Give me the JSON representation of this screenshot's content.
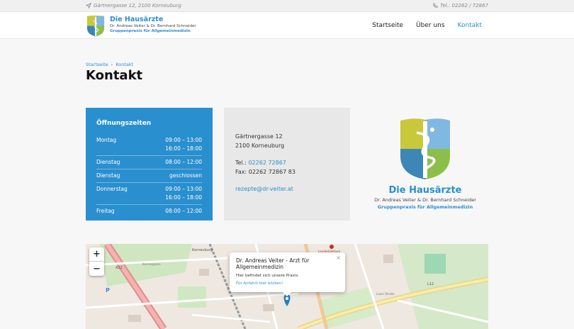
{
  "topbar": {
    "address": "Gärtnergasse 12, 2100 Korneuburg",
    "phone": "Tel.: 02262 / 72867"
  },
  "brand": {
    "name": "Die Hausärzte",
    "doctors": "Dr. Andreas Veiter & Dr. Bernhard Schneider",
    "tagline": "Gruppenpraxis für Allgemeinmedizin"
  },
  "nav": {
    "items": [
      "Startseite",
      "Über uns",
      "Kontakt"
    ],
    "active": "Kontakt"
  },
  "breadcrumb": {
    "home": "Startseite",
    "separator": "›",
    "current": "Kontakt"
  },
  "page_title": "Kontakt",
  "hours": {
    "title": "Öffnungszeiten",
    "rows": [
      {
        "day": "Montag",
        "t1": "09:00 – 13:00",
        "t2": "16:00 – 18:00"
      },
      {
        "day": "Dienstag",
        "t1": "08:00 – 12:00",
        "t2": ""
      },
      {
        "day": "Dienstag",
        "t1": "geschlossen",
        "t2": ""
      },
      {
        "day": "Donnerstag",
        "t1": "09:00 – 13:00",
        "t2": "16:00 – 18:00"
      },
      {
        "day": "Freitag",
        "t1": "08:00 – 12:00",
        "t2": ""
      }
    ]
  },
  "contact": {
    "street": "Gärtnergasse 12",
    "city": "2100 Korneuburg",
    "tel_label": "Tel.: ",
    "tel": "02262 72867",
    "fax": "Fax: 02262 72867 83",
    "email": "rezepte@dr-veiter.at"
  },
  "map": {
    "zoom_in": "+",
    "zoom_out": "−",
    "popup": {
      "title": "Dr. Andreas Veiter - Arzt für Allgemeinmedizin",
      "desc": "Hier befindet sich unsere Praxis.",
      "link": "Für Anfahrt hier klicken!",
      "close": "×"
    },
    "labels": {
      "korneuburg": "Korneuburg",
      "a22": "A22",
      "l12": "L12",
      "parking": "P",
      "landeskl": "Landesklinikum",
      "street1": "Kennergasse",
      "street2": "Laaer Straße"
    }
  },
  "colors": {
    "accent": "#2a8fcf",
    "hours_bg": "#2a8fcf",
    "contact_bg": "#e8e8e8"
  }
}
